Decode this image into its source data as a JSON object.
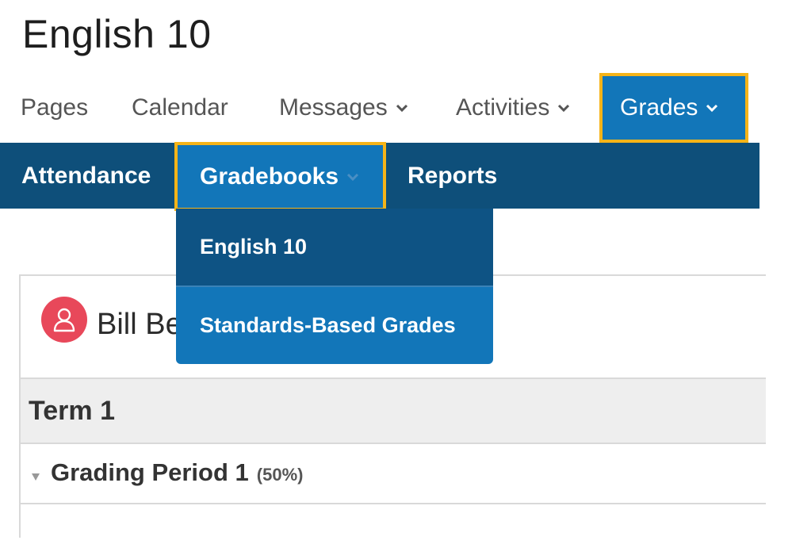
{
  "page": {
    "title": "English 10"
  },
  "main_nav": {
    "items": [
      {
        "label": "Pages",
        "has_chevron": false
      },
      {
        "label": "Calendar",
        "has_chevron": false
      },
      {
        "label": "Messages",
        "has_chevron": true
      },
      {
        "label": "Activities",
        "has_chevron": true
      },
      {
        "label": "Grades",
        "has_chevron": true,
        "active": true
      }
    ]
  },
  "sub_nav": {
    "items": [
      {
        "label": "Attendance"
      },
      {
        "label": "Gradebooks",
        "has_chevron": true,
        "active": true
      },
      {
        "label": "Reports"
      }
    ]
  },
  "gradebooks_dropdown": {
    "items": [
      {
        "label": "English 10"
      },
      {
        "label": "Standards-Based Grades"
      }
    ]
  },
  "student_card": {
    "name": "Bill Be",
    "avatar_icon": "person-icon",
    "term": "Term 1",
    "grading_period": {
      "label": "Grading Period 1",
      "weight": "(50%)"
    }
  },
  "colors": {
    "primary_blue": "#1276b9",
    "dark_blue": "#0e4f7a",
    "highlight_border": "#f6b418",
    "avatar_red": "#e8485a"
  }
}
